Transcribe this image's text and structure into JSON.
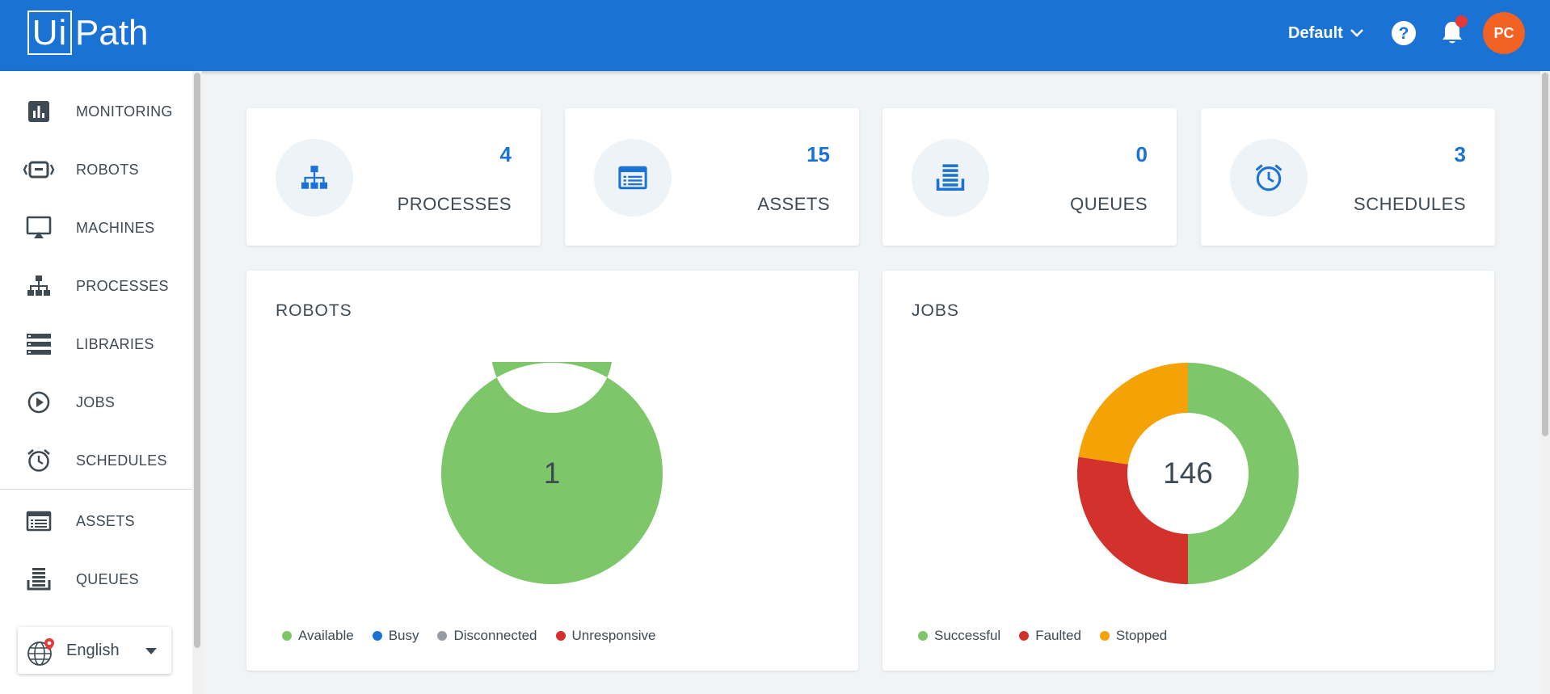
{
  "header": {
    "logo_boxed": "Ui",
    "logo_rest": "Path",
    "tenant": "Default",
    "avatar_initials": "PC",
    "brand_color": "#1a73d4",
    "avatar_color": "#f26222"
  },
  "sidebar": {
    "items": [
      {
        "label": "MONITORING",
        "icon": "monitoring-icon"
      },
      {
        "label": "ROBOTS",
        "icon": "robot-icon"
      },
      {
        "label": "MACHINES",
        "icon": "machine-icon"
      },
      {
        "label": "PROCESSES",
        "icon": "processes-icon"
      },
      {
        "label": "LIBRARIES",
        "icon": "libraries-icon"
      },
      {
        "label": "JOBS",
        "icon": "play-circle-icon"
      },
      {
        "label": "SCHEDULES",
        "icon": "alarm-clock-icon"
      },
      {
        "label": "ASSETS",
        "icon": "assets-icon"
      },
      {
        "label": "QUEUES",
        "icon": "queue-icon"
      }
    ],
    "language": "English"
  },
  "stats": [
    {
      "count": "4",
      "label": "PROCESSES",
      "icon": "processes-icon"
    },
    {
      "count": "15",
      "label": "ASSETS",
      "icon": "assets-icon"
    },
    {
      "count": "0",
      "label": "QUEUES",
      "icon": "queue-icon"
    },
    {
      "count": "3",
      "label": "SCHEDULES",
      "icon": "alarm-clock-icon"
    }
  ],
  "robots_card": {
    "title": "ROBOTS",
    "center": "1"
  },
  "jobs_card": {
    "title": "JOBS",
    "center": "146"
  },
  "chart_data": [
    {
      "type": "pie",
      "title": "ROBOTS",
      "total": 1,
      "categories": [
        "Available",
        "Busy",
        "Disconnected",
        "Unresponsive"
      ],
      "values": [
        1,
        0,
        0,
        0
      ],
      "colors": [
        "#7dc76a",
        "#1a73d4",
        "#959ca3",
        "#d3312c"
      ],
      "legend_position": "bottom-left"
    },
    {
      "type": "pie",
      "title": "JOBS",
      "total": 146,
      "categories": [
        "Successful",
        "Faulted",
        "Stopped"
      ],
      "values": [
        73,
        40,
        33
      ],
      "colors": [
        "#7dc76a",
        "#d3312c",
        "#f5a207"
      ],
      "legend_position": "bottom-left"
    }
  ]
}
